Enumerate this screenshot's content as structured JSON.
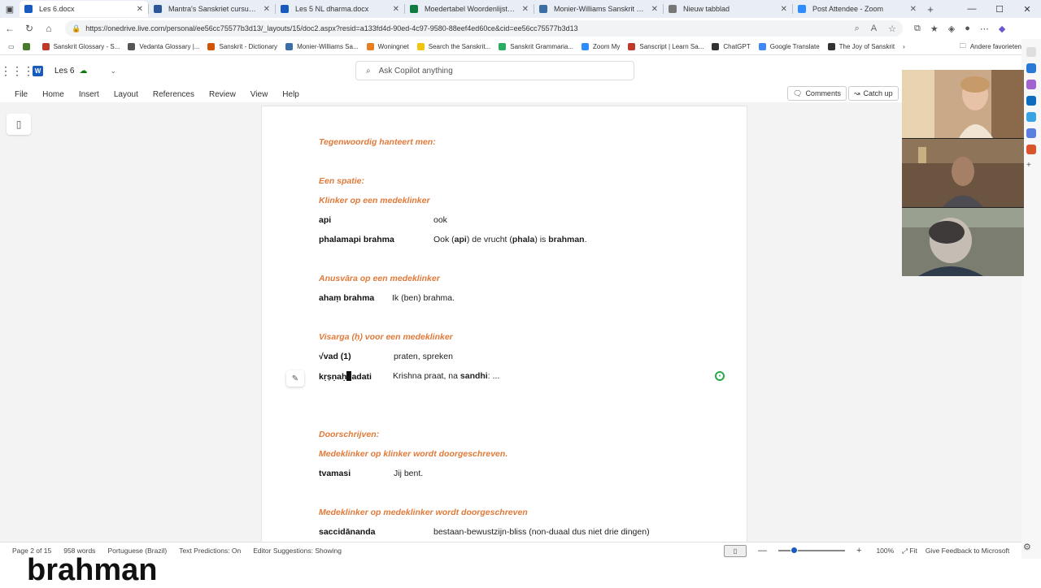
{
  "browser": {
    "tabs": [
      {
        "label": "Les 6.docx",
        "active": true,
        "color": "#185abd"
      },
      {
        "label": "Mantra's Sanskriet cursus 1.docx",
        "active": false,
        "color": "#2b579a"
      },
      {
        "label": "Les 5 NL dharma.docx",
        "active": false,
        "color": "#185abd"
      },
      {
        "label": "Moedertabel Woordenlijsten San",
        "active": false,
        "color": "#107c41"
      },
      {
        "label": "Monier-Williams Sanskrit Diction",
        "active": false,
        "color": "#3a6ea5"
      },
      {
        "label": "Nieuw tabblad",
        "active": false,
        "color": "#777777"
      },
      {
        "label": "Post Attendee - Zoom",
        "active": false,
        "color": "#2d8cff"
      }
    ],
    "url": "https://onedrive.live.com/personal/ee56cc75577b3d13/_layouts/15/doc2.aspx?resid=a133fd4d-90ed-4c97-9580-88eef4ed60ce&cid=ee56cc75577b3d13",
    "bookmarks": [
      {
        "label": "Sanskrit Glossary - S...",
        "color": "#c0392b"
      },
      {
        "label": "Vedanta Glossary |...",
        "color": "#555555"
      },
      {
        "label": "Sanskrit - Dictionary",
        "color": "#d35400"
      },
      {
        "label": "Monier-Williams Sa...",
        "color": "#3a6ea5"
      },
      {
        "label": "Woningnet",
        "color": "#e67e22"
      },
      {
        "label": "Search the Sanskrit...",
        "color": "#f1c40f"
      },
      {
        "label": "Sanskrit Grammaria...",
        "color": "#27ae60"
      },
      {
        "label": "Zoom My",
        "color": "#2d8cff"
      },
      {
        "label": "Sanscript | Learn Sa...",
        "color": "#c0392b"
      },
      {
        "label": "ChatGPT",
        "color": "#333333"
      },
      {
        "label": "Google Translate",
        "color": "#4285f4"
      },
      {
        "label": "The Joy of Sanskrit",
        "color": "#333333"
      }
    ],
    "other_favorites": "Andere favorieten"
  },
  "app": {
    "doc_name": "Les 6",
    "copilot_placeholder": "Ask Copilot anything",
    "menu": [
      "File",
      "Home",
      "Insert",
      "Layout",
      "References",
      "Review",
      "View",
      "Help"
    ],
    "comments_label": "Comments",
    "catchup_label": "Catch up"
  },
  "document": {
    "lines": [
      {
        "kind": "heading",
        "text": "Tegenwoordig hanteert men:"
      },
      {
        "kind": "heading",
        "text": "Een spatie:"
      },
      {
        "kind": "heading",
        "text": "Klinker op een medeklinker"
      },
      {
        "kind": "pair",
        "term": "api",
        "translation_plain": "ook"
      },
      {
        "kind": "pair",
        "term": "phalamapi brahma",
        "translation_rich": "Ook (api) de vrucht (phala) is brahman."
      },
      {
        "kind": "heading",
        "text": "Anusvāra op een medeklinker"
      },
      {
        "kind": "pair",
        "term": "ahaṃ brahma",
        "translation_plain": "Ik (ben) brahma."
      },
      {
        "kind": "heading",
        "text": "Visarga (ḥ) voor een medeklinker"
      },
      {
        "kind": "pair",
        "term": "√vad (1)",
        "translation_plain": "praten, spreken"
      },
      {
        "kind": "pair",
        "term": "kṛṣṇaḥ vadati",
        "translation_rich": "Krishna praat, na sandhi: ..."
      },
      {
        "kind": "heading",
        "text": "Doorschrijven:"
      },
      {
        "kind": "heading",
        "text": "Medeklinker op klinker wordt doorgeschreven."
      },
      {
        "kind": "pair",
        "term": "tvamasi",
        "translation_plain": "Jij bent."
      },
      {
        "kind": "heading",
        "text": "Medeklinker op medeklinker wordt doorgeschreven"
      },
      {
        "kind": "pair",
        "term": "saccidānanda",
        "translation_plain": "bestaan-bewustzijn-bliss (non-duaal dus niet drie dingen)"
      }
    ],
    "rich": {
      "phala_pre": "Ook (",
      "phala_api": "api",
      "phala_mid": ") de vrucht (",
      "phala_phala": "phala",
      "phala_post": ") is ",
      "phala_brahman": "brahman",
      "phala_end": ".",
      "krishna_pre": "Krishna praat, na ",
      "krishna_sandhi": "sandhi",
      "krishna_post": ": ...",
      "krishna_term_a": "kṛṣṇaḥ",
      "krishna_term_b": "adati"
    }
  },
  "status": {
    "page": "Page 2 of 15",
    "words": "958 words",
    "language": "Portuguese (Brazil)",
    "predictions": "Text Predictions: On",
    "editor": "Editor Suggestions: Showing",
    "zoom": "100%",
    "zoom_fraction": 0.2,
    "fit": "Fit",
    "feedback": "Give Feedback to Microsoft"
  },
  "caption": "brahman",
  "colors": {
    "heading": "#e07a3a",
    "word_blue": "#185abd"
  }
}
